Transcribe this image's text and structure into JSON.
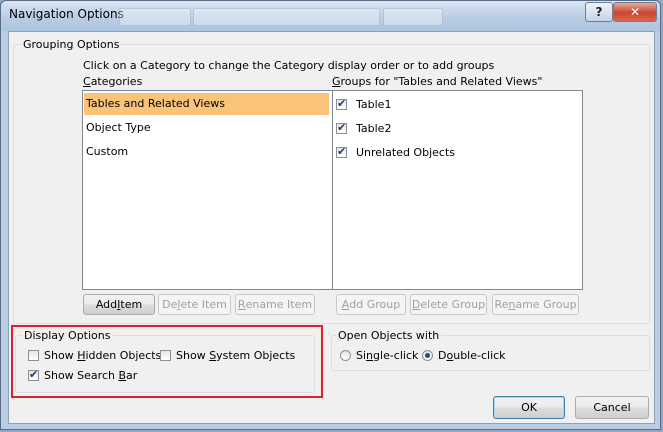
{
  "window": {
    "title": "Navigation Options",
    "help_button": "?",
    "close_button": "✕"
  },
  "grouping": {
    "legend": "Grouping Options",
    "instruction": "Click on a Category to change the Category display order or to add groups",
    "categories_label_u": "C",
    "categories_label_rest": "ategories",
    "groups_label_u": "G",
    "groups_label_rest": "roups for \"Tables and Related Views\"",
    "categories": [
      {
        "label": "Tables and Related Views",
        "selected": true
      },
      {
        "label": "Object Type",
        "selected": false
      },
      {
        "label": "Custom",
        "selected": false
      }
    ],
    "groups": [
      {
        "label": "Table1",
        "checked": true
      },
      {
        "label": "Table2",
        "checked": true
      },
      {
        "label": "Unrelated Objects",
        "checked": true
      }
    ],
    "buttons": {
      "add_item_pre": "Add ",
      "add_item_u": "I",
      "add_item_post": "tem",
      "delete_item_pre": "De",
      "delete_item_u": "l",
      "delete_item_post": "ete Item",
      "rename_item_pre": "",
      "rename_item_u": "R",
      "rename_item_post": "ename Item",
      "add_group_pre": "",
      "add_group_u": "A",
      "add_group_post": "dd Group",
      "delete_group_pre": "",
      "delete_group_u": "D",
      "delete_group_post": "elete Group",
      "rename_group_pre": "Re",
      "rename_group_u": "n",
      "rename_group_post": "ame Group"
    }
  },
  "display": {
    "legend": "Display Options",
    "show_hidden_pre": "Show ",
    "show_hidden_u": "H",
    "show_hidden_post": "idden Objects",
    "show_hidden_checked": false,
    "show_system_pre": "Show ",
    "show_system_u": "S",
    "show_system_post": "ystem Objects",
    "show_system_checked": false,
    "show_search_pre": "Show Search ",
    "show_search_u": "B",
    "show_search_post": "ar",
    "show_search_checked": true
  },
  "open_objects": {
    "legend": "Open Objects with",
    "single_pre": "Si",
    "single_u": "n",
    "single_post": "gle-click",
    "single_checked": false,
    "double_pre": "D",
    "double_u": "o",
    "double_post": "uble-click",
    "double_checked": true
  },
  "footer": {
    "ok": "OK",
    "cancel": "Cancel"
  },
  "colors": {
    "selected_row": "#f9c47a",
    "highlight_border": "#e0202a",
    "title_bar": "#b9cde4"
  }
}
